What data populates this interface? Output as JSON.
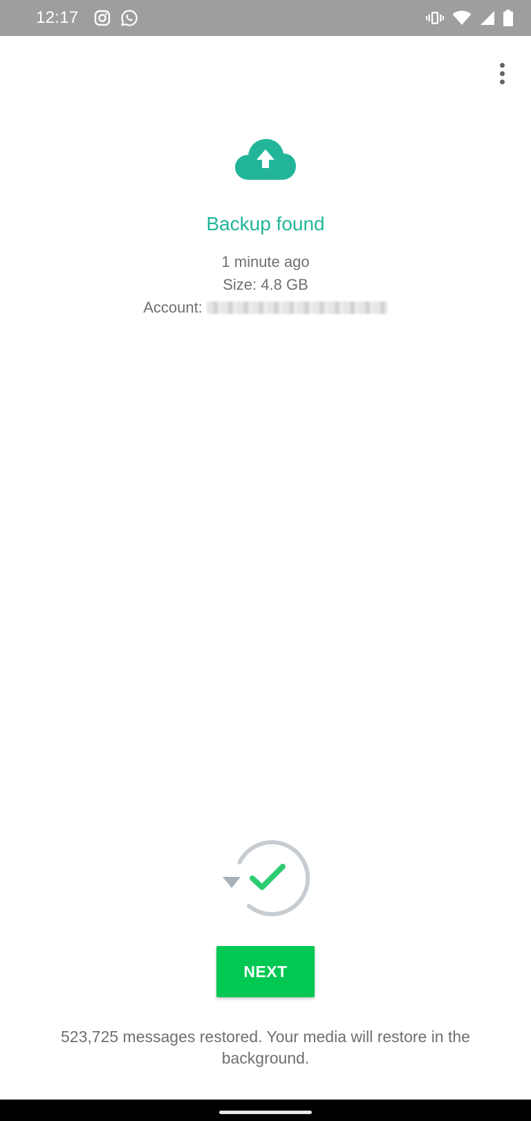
{
  "status_bar": {
    "time": "12:17",
    "left_icons": [
      "instagram-icon",
      "whatsapp-icon"
    ],
    "right_icons": [
      "vibrate-icon",
      "wifi-icon",
      "cell-signal-icon",
      "battery-icon"
    ]
  },
  "menu": {
    "icon": "more-vert-icon"
  },
  "backup": {
    "icon": "cloud-upload-icon",
    "title": "Backup found",
    "time": "1 minute ago",
    "size": "Size: 4.8 GB",
    "account_label": "Account:"
  },
  "restore": {
    "icon": "restore-check-icon",
    "next_label": "NEXT",
    "status_message": "523,725 messages restored. Your media will restore in the background."
  },
  "colors": {
    "accent": "#22b59a",
    "button": "#00c853",
    "check": "#2ecc71",
    "status_bar": "#9e9e9e"
  }
}
